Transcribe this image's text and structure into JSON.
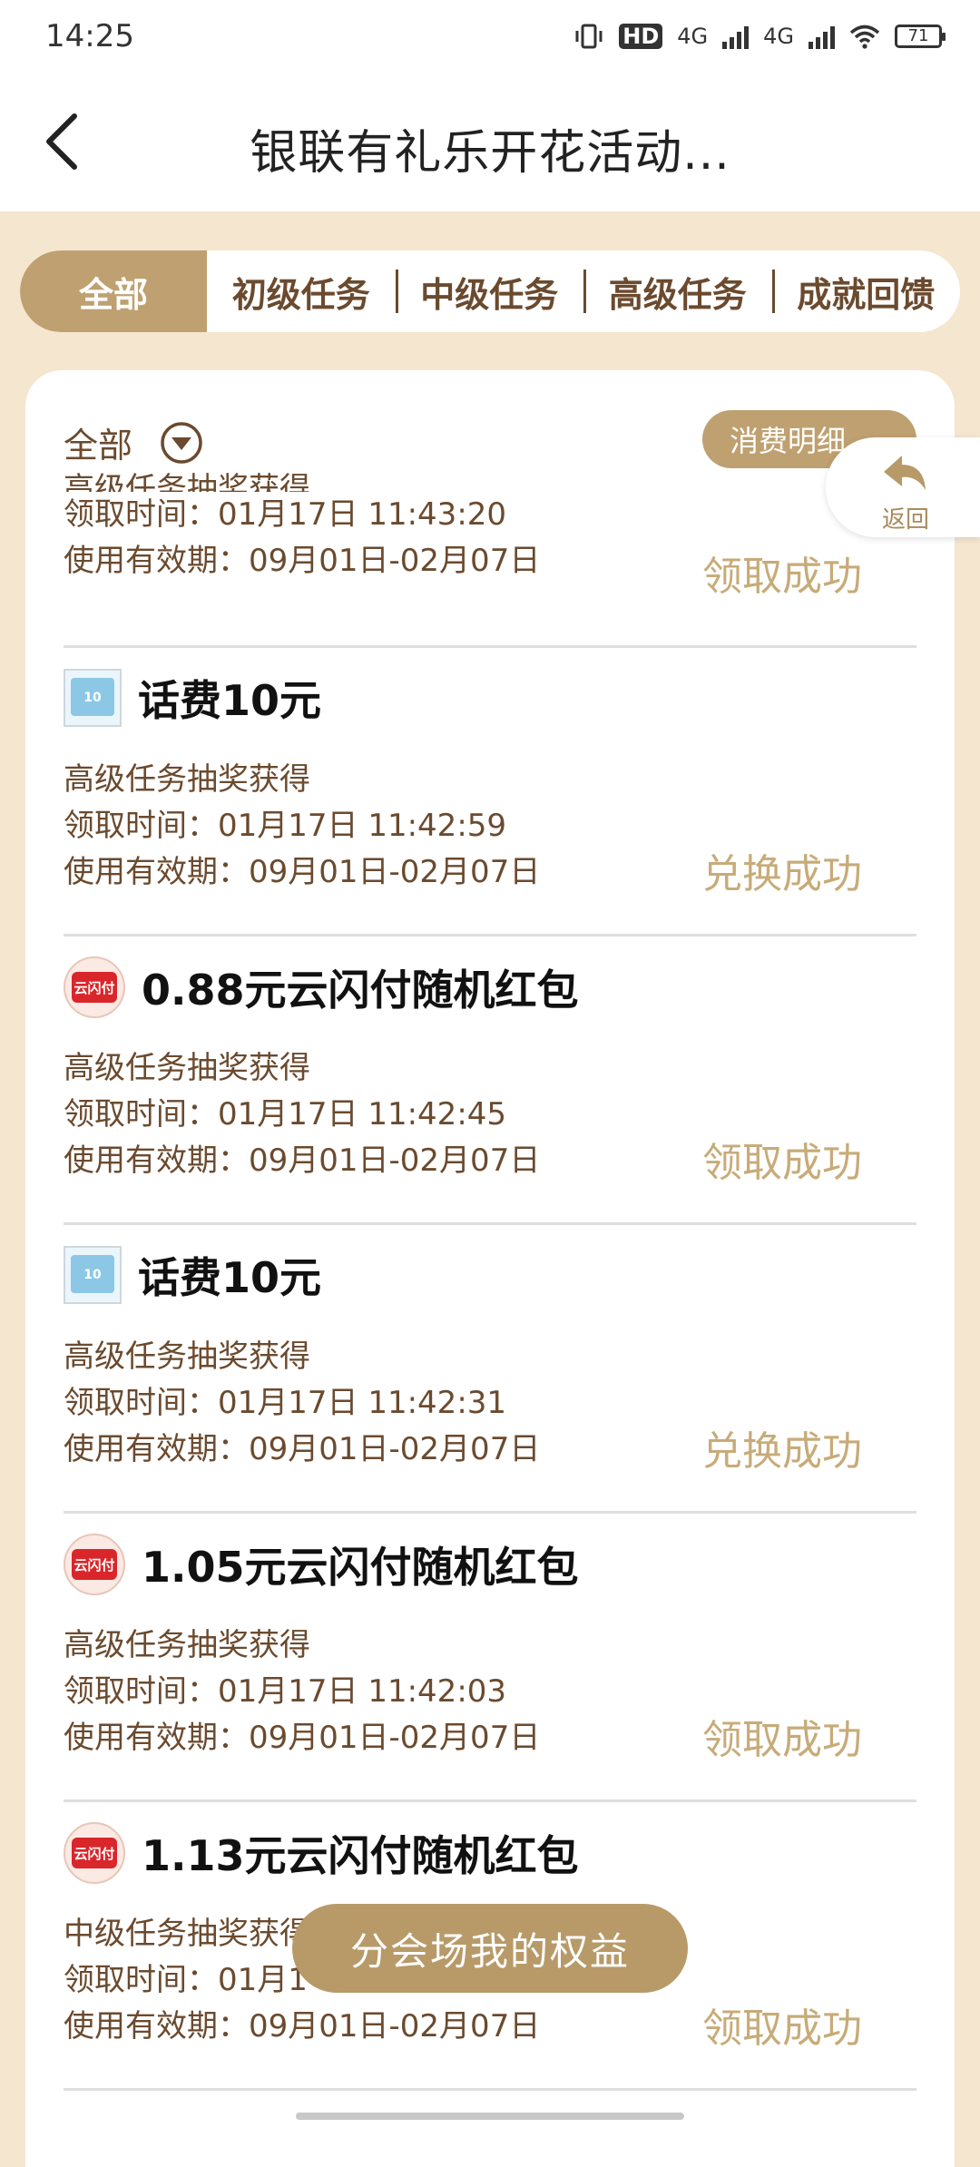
{
  "status_bar": {
    "time": "14:25",
    "hd_label": "HD",
    "network_1": "4G",
    "network_2": "4G",
    "battery": "71"
  },
  "nav": {
    "title": "银联有礼乐开花活动..."
  },
  "tabs": {
    "active": "全部",
    "items": [
      "初级任务",
      "中级任务",
      "高级任务",
      "成就回馈"
    ]
  },
  "filter": {
    "label": "全部"
  },
  "detail_button": "消费明细",
  "float_return": "返回",
  "items": [
    {
      "title": "",
      "source": "高级任务抽奖获得",
      "claim_time": "领取时间：01月17日 11:43:20",
      "validity": "使用有效期：09月01日-02月07日",
      "status": "领取成功"
    },
    {
      "title": "话费10元",
      "icon": "recharge-card-icon",
      "source": "高级任务抽奖获得",
      "claim_time": "领取时间：01月17日 11:42:59",
      "validity": "使用有效期：09月01日-02月07日",
      "status": "兑换成功"
    },
    {
      "title": "0.88元云闪付随机红包",
      "icon": "cloud-pay-icon",
      "icon_text": "云闪付",
      "source": "高级任务抽奖获得",
      "claim_time": "领取时间：01月17日 11:42:45",
      "validity": "使用有效期：09月01日-02月07日",
      "status": "领取成功"
    },
    {
      "title": "话费10元",
      "icon": "recharge-card-icon",
      "source": "高级任务抽奖获得",
      "claim_time": "领取时间：01月17日 11:42:31",
      "validity": "使用有效期：09月01日-02月07日",
      "status": "兑换成功"
    },
    {
      "title": "1.05元云闪付随机红包",
      "icon": "cloud-pay-icon",
      "icon_text": "云闪付",
      "source": "高级任务抽奖获得",
      "claim_time": "领取时间：01月17日 11:42:03",
      "validity": "使用有效期：09月01日-02月07日",
      "status": "领取成功"
    },
    {
      "title": "1.13元云闪付随机红包",
      "icon": "cloud-pay-icon",
      "icon_text": "云闪付",
      "source": "中级任务抽奖获得",
      "claim_time": "领取时间：01月1",
      "validity": "使用有效期：09月01日-02月07日",
      "status": "领取成功"
    }
  ],
  "bottom_button": "分会场我的权益",
  "colors": {
    "accent": "#bfa070",
    "background": "#f4e6cf",
    "text_brown": "#6b4a2e",
    "status_gold": "#c7ab78"
  }
}
